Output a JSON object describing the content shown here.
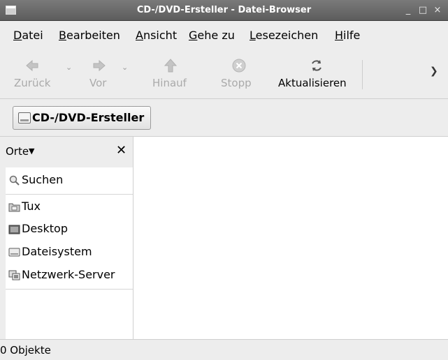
{
  "window": {
    "title": "CD-/DVD-Ersteller - Datei-Browser",
    "controls": [
      "_",
      "□",
      "×"
    ]
  },
  "menu": [
    {
      "mnemonic": "D",
      "rest": "atei"
    },
    {
      "mnemonic": "B",
      "rest": "earbeiten"
    },
    {
      "mnemonic": "A",
      "rest": "nsicht"
    },
    {
      "mnemonic": "G",
      "rest": "ehe zu"
    },
    {
      "mnemonic": "L",
      "rest": "esezeichen"
    },
    {
      "mnemonic": "H",
      "rest": "ilfe"
    }
  ],
  "toolbar": {
    "back": {
      "label": "Zurück",
      "icon": "arrow-left-icon",
      "enabled": false
    },
    "forward": {
      "label": "Vor",
      "icon": "arrow-right-icon",
      "enabled": false
    },
    "up": {
      "label": "Hinauf",
      "icon": "arrow-up-icon",
      "enabled": false
    },
    "stop": {
      "label": "Stopp",
      "icon": "stop-icon",
      "enabled": false
    },
    "reload": {
      "label": "Aktualisieren",
      "icon": "reload-icon",
      "enabled": true
    }
  },
  "location": {
    "button_label": "CD-/DVD-Ersteller",
    "icon": "optical-drive-icon"
  },
  "sidepane": {
    "header_label": "Orte",
    "items": [
      {
        "label": "Suchen",
        "icon": "search-icon"
      },
      {
        "label": "Tux",
        "icon": "home-folder-icon"
      },
      {
        "label": "Desktop",
        "icon": "desktop-icon"
      },
      {
        "label": "Dateisystem",
        "icon": "harddisk-icon"
      },
      {
        "label": "Netzwerk-Server",
        "icon": "network-server-icon"
      }
    ]
  },
  "statusbar": {
    "text": "0 Objekte"
  }
}
